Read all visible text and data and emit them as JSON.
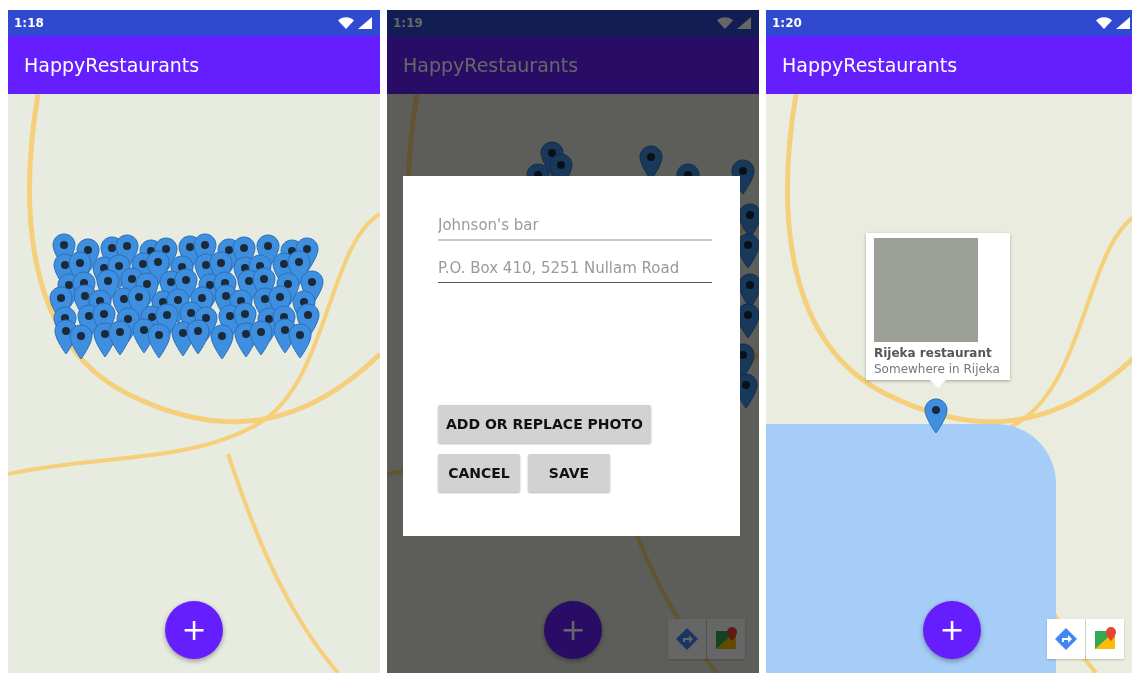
{
  "screens": [
    {
      "time": "1:18",
      "app_title": "HappyRestaurants",
      "kind": "cluster",
      "dimmed": false,
      "fab_label": "+",
      "map_toolbar": false
    },
    {
      "time": "1:19",
      "app_title": "HappyRestaurants",
      "kind": "scattered",
      "dimmed": true,
      "fab_label": "+",
      "map_toolbar": true,
      "dialog": {
        "fields": [
          {
            "placeholder": "Johnson's bar",
            "focused": false
          },
          {
            "placeholder": "P.O. Box 410, 5251 Nullam Road",
            "focused": true
          }
        ],
        "photo_button": "ADD OR REPLACE PHOTO",
        "buttons": [
          "CANCEL",
          "SAVE"
        ]
      }
    },
    {
      "time": "1:20",
      "app_title": "HappyRestaurants",
      "kind": "single",
      "dimmed": false,
      "fab_label": "+",
      "map_toolbar": true,
      "info_window": {
        "title": "Rijeka restaurant",
        "subtitle": "Somewhere in Rijeka"
      }
    }
  ]
}
